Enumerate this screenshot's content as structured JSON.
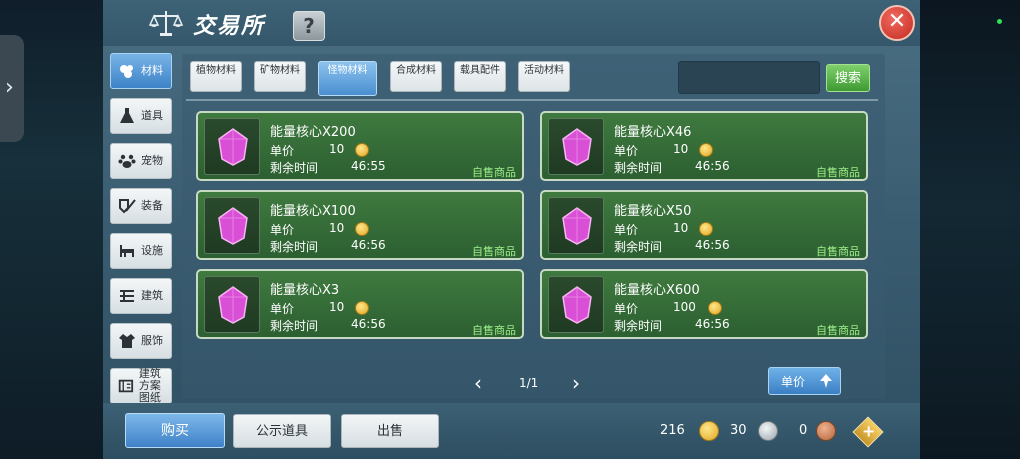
{
  "header": {
    "title": "交易所",
    "help_label": "?",
    "close_label": "✕"
  },
  "categories": [
    {
      "label": "材料",
      "icon": "materials-icon",
      "active": true
    },
    {
      "label": "道具",
      "icon": "flask-icon",
      "active": false
    },
    {
      "label": "宠物",
      "icon": "paw-icon",
      "active": false
    },
    {
      "label": "装备",
      "icon": "equipment-icon",
      "active": false
    },
    {
      "label": "设施",
      "icon": "facility-icon",
      "active": false
    },
    {
      "label": "建筑",
      "icon": "building-icon",
      "active": false
    },
    {
      "label": "服饰",
      "icon": "clothing-icon",
      "active": false
    },
    {
      "label": "建筑方案图纸",
      "icon": "blueprint-icon",
      "active": false
    }
  ],
  "subtabs": [
    {
      "label": "植物材料",
      "active": false
    },
    {
      "label": "矿物材料",
      "active": false
    },
    {
      "label": "怪物材料",
      "active": true
    },
    {
      "label": "合成材料",
      "active": false
    },
    {
      "label": "载具配件",
      "active": false
    },
    {
      "label": "活动材料",
      "active": false
    }
  ],
  "search": {
    "button_label": "搜索",
    "value": ""
  },
  "listings": [
    {
      "name": "能量核心X200",
      "price_label": "单价",
      "price": "10",
      "time_label": "剩余时间",
      "time": "46:55",
      "tag": "自售商品"
    },
    {
      "name": "能量核心X46",
      "price_label": "单价",
      "price": "10",
      "time_label": "剩余时间",
      "time": "46:56",
      "tag": "自售商品"
    },
    {
      "name": "能量核心X100",
      "price_label": "单价",
      "price": "10",
      "time_label": "剩余时间",
      "time": "46:56",
      "tag": "自售商品"
    },
    {
      "name": "能量核心X50",
      "price_label": "单价",
      "price": "10",
      "time_label": "剩余时间",
      "time": "46:56",
      "tag": "自售商品"
    },
    {
      "name": "能量核心X3",
      "price_label": "单价",
      "price": "10",
      "time_label": "剩余时间",
      "time": "46:56",
      "tag": "自售商品"
    },
    {
      "name": "能量核心X600",
      "price_label": "单价",
      "price": "100",
      "time_label": "剩余时间",
      "time": "46:56",
      "tag": "自售商品"
    }
  ],
  "pagination": {
    "text": "1/1"
  },
  "sort": {
    "label": "单价"
  },
  "bottom": {
    "buy_label": "购买",
    "display_label": "公示道具",
    "sell_label": "出售"
  },
  "currency": {
    "gold": "216",
    "silver": "30",
    "bronze": "0"
  },
  "colors": {
    "accent_blue": "#3f82c8",
    "card_green": "#2c5f31",
    "tag_green": "#9ff08a",
    "gem_purple": "#d94fd6"
  }
}
